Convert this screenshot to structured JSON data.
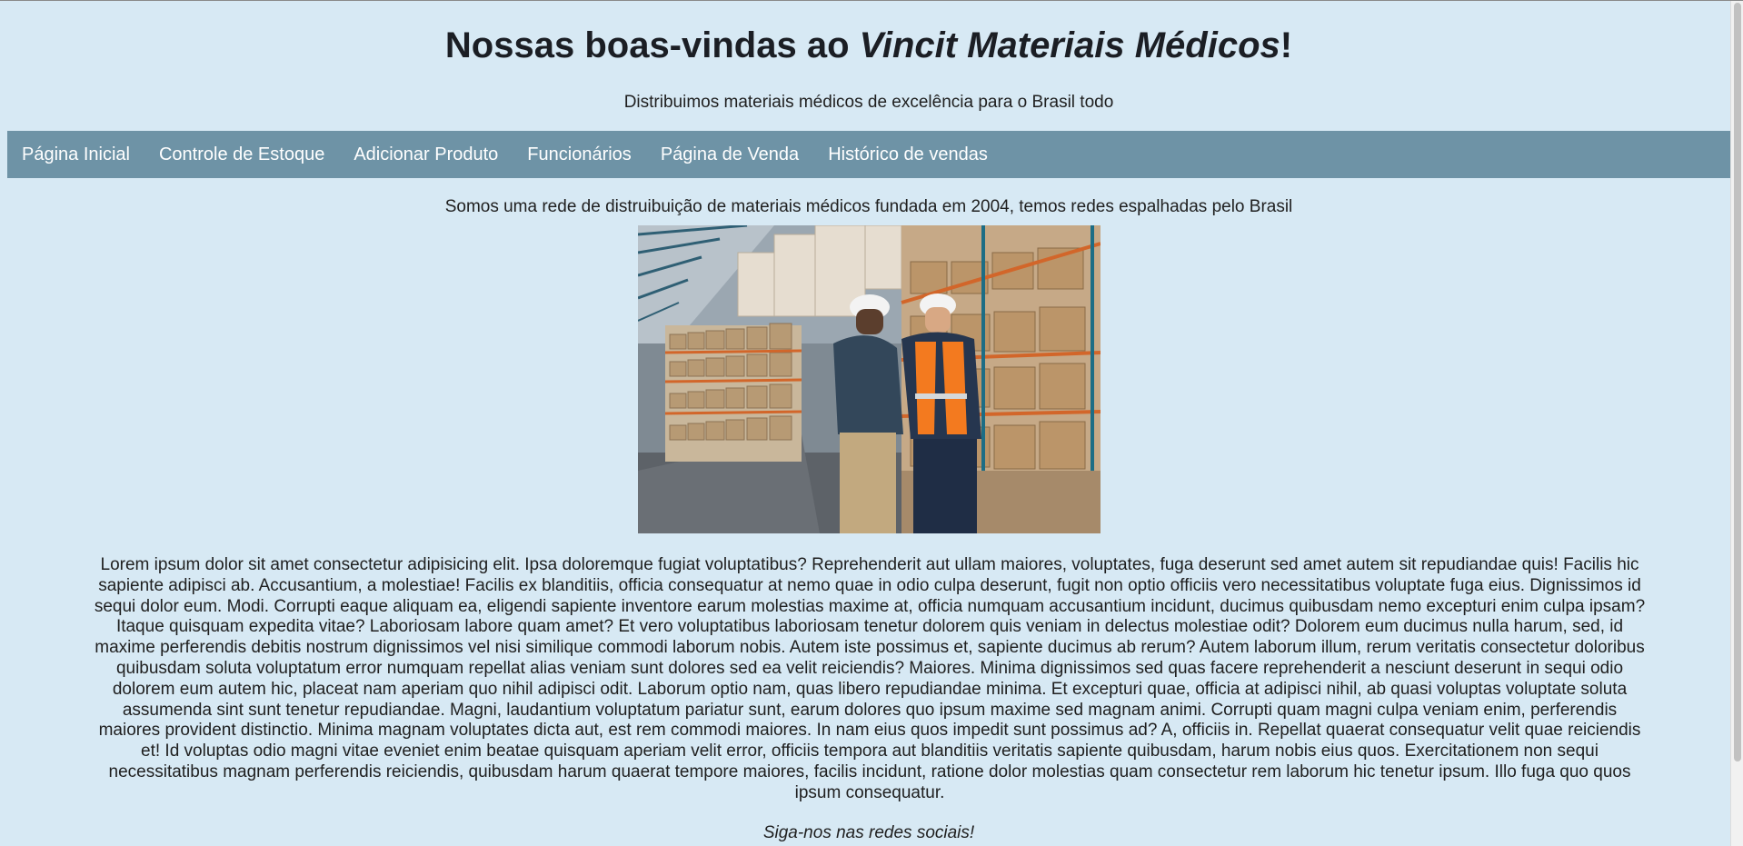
{
  "header": {
    "title_prefix": "Nossas boas-vindas ao ",
    "title_brand": "Vincit Materiais Médicos",
    "title_suffix": "!",
    "subtitle": "Distribuimos materiais médicos de excelência para o Brasil todo"
  },
  "nav": {
    "items": [
      {
        "label": "Página Inicial"
      },
      {
        "label": "Controle de Estoque"
      },
      {
        "label": "Adicionar Produto"
      },
      {
        "label": "Funcionários"
      },
      {
        "label": "Página de Venda"
      },
      {
        "label": "Histórico de vendas"
      }
    ]
  },
  "main": {
    "intro": "Somos uma rede de distruibuição de materiais médicos fundada em 2004, temos redes espalhadas pelo Brasil",
    "body_text": "Lorem ipsum dolor sit amet consectetur adipisicing elit. Ipsa doloremque fugiat voluptatibus? Reprehenderit aut ullam maiores, voluptates, fuga deserunt sed amet autem sit repudiandae quis! Facilis hic sapiente adipisci ab. Accusantium, a molestiae! Facilis ex blanditiis, officia consequatur at nemo quae in odio culpa deserunt, fugit non optio officiis vero necessitatibus voluptate fuga eius. Dignissimos id sequi dolor eum. Modi. Corrupti eaque aliquam ea, eligendi sapiente inventore earum molestias maxime at, officia numquam accusantium incidunt, ducimus quibusdam nemo excepturi enim culpa ipsam? Itaque quisquam expedita vitae? Laboriosam labore quam amet? Et vero voluptatibus laboriosam tenetur dolorem quis veniam in delectus molestiae odit? Dolorem eum ducimus nulla harum, sed, id maxime perferendis debitis nostrum dignissimos vel nisi similique commodi laborum nobis. Autem iste possimus et, sapiente ducimus ab rerum? Autem laborum illum, rerum veritatis consectetur doloribus quibusdam soluta voluptatum error numquam repellat alias veniam sunt dolores sed ea velit reiciendis? Maiores. Minima dignissimos sed quas facere reprehenderit a nesciunt deserunt in sequi odio dolorem eum autem hic, placeat nam aperiam quo nihil adipisci odit. Laborum optio nam, quas libero repudiandae minima. Et excepturi quae, officia at adipisci nihil, ab quasi voluptas voluptate soluta assumenda sint sunt tenetur repudiandae. Magni, laudantium voluptatum pariatur sunt, earum dolores quo ipsum maxime sed magnam animi. Corrupti quam magni culpa veniam enim, perferendis maiores provident distinctio. Minima magnam voluptates dicta aut, est rem commodi maiores. In nam eius quos impedit sunt possimus ad? A, officiis in. Repellat quaerat consequatur velit quae reiciendis et! Id voluptas odio magni vitae eveniet enim beatae quisquam aperiam velit error, officiis tempora aut blanditiis veritatis sapiente quibusdam, harum nobis eius quos. Exercitationem non sequi necessitatibus magnam perferendis reiciendis, quibusdam harum quaerat tempore maiores, facilis incidunt, ratione dolor molestias quam consectetur rem laborum hic tenetur ipsum. Illo fuga quo quos ipsum consequatur.",
    "social": "Siga-nos nas redes sociais!"
  },
  "colors": {
    "background": "#d7e9f4",
    "navbar": "#6e93a6",
    "nav_text": "#ffffff"
  }
}
